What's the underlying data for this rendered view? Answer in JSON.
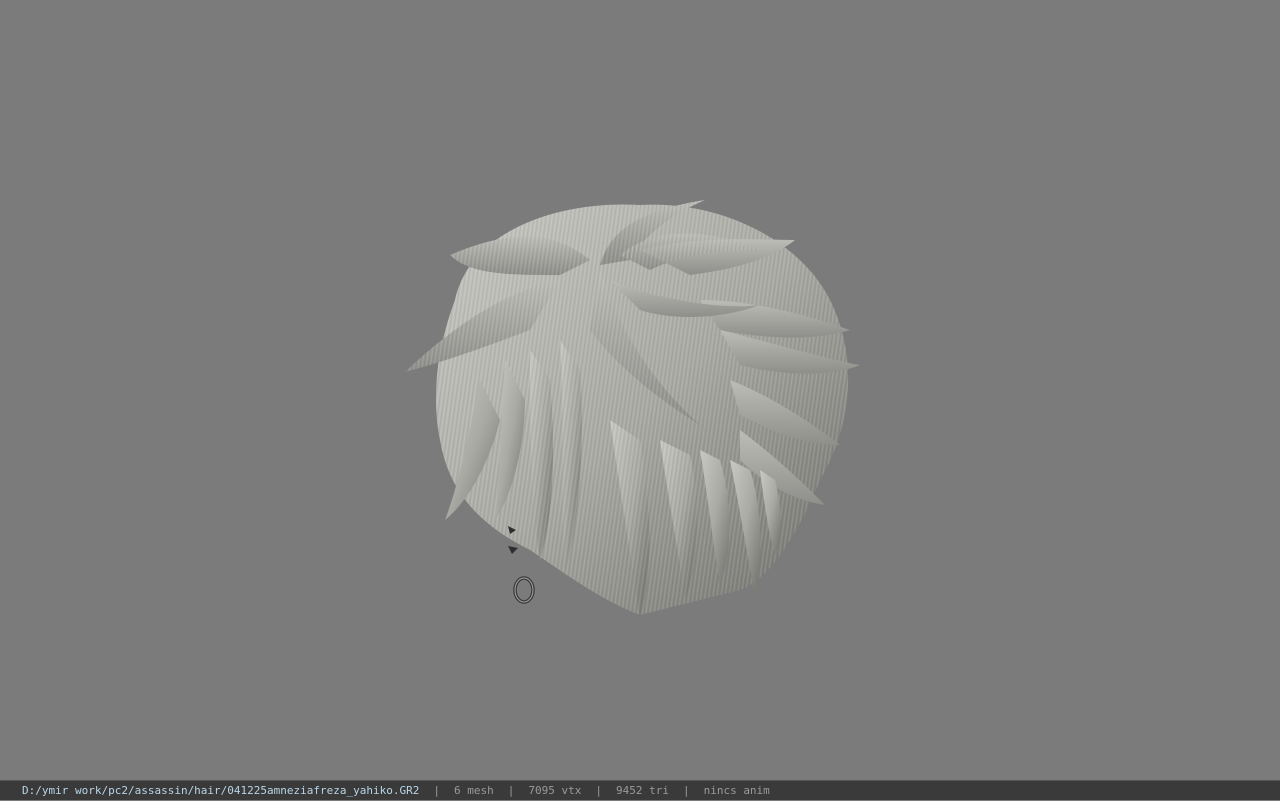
{
  "viewport": {
    "background": "#7b7b7b",
    "model_icon": "hair-mesh"
  },
  "statusbar": {
    "path": "D:/ymir work/pc2/assassin/hair/041225amneziafreza_yahiko.GR2",
    "separator": "|",
    "mesh": "6 mesh",
    "vtx": "7095 vtx",
    "tri": "9452 tri",
    "anim": "nincs anim",
    "path_color": "#b8d4e6",
    "text_color": "#9a9a9a"
  }
}
